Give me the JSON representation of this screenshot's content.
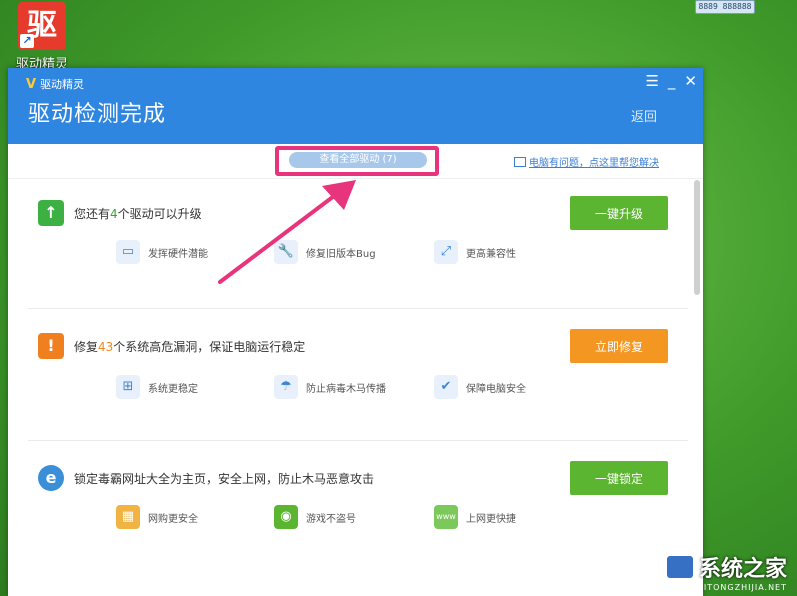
{
  "desktop": {
    "shortcut_label": "驱动精灵",
    "shortcut_logo_char": "驱",
    "tray_text": "8889 888888"
  },
  "window": {
    "app_name": "驱动精灵",
    "title": "驱动检测完成",
    "back_label": "返回",
    "controls": {
      "menu": "☰",
      "minimize": "_",
      "close": "✕"
    },
    "accent": "#2f86e0"
  },
  "toolbar": {
    "view_all_label": "查看全部驱动 (7)",
    "help_link": "电脑有问题，点这里帮您解决"
  },
  "sections": [
    {
      "pre": "您还有",
      "count": "4",
      "post": "个驱动可以升级",
      "button": "一键升级",
      "button_color": "#5cb531",
      "icon_color": "#3cb043",
      "features": [
        {
          "label": "发挥硬件潜能",
          "icon": "monitor-icon"
        },
        {
          "label": "修复旧版本Bug",
          "icon": "wrench-icon"
        },
        {
          "label": "更高兼容性",
          "icon": "expand-icon"
        }
      ]
    },
    {
      "pre": "修复",
      "count": "43",
      "post": "个系统高危漏洞，保证电脑运行稳定",
      "button": "立即修复",
      "button_color": "#f39722",
      "icon_color": "#f07f1f",
      "features": [
        {
          "label": "系统更稳定",
          "icon": "windows-icon"
        },
        {
          "label": "防止病毒木马传播",
          "icon": "umbrella-icon"
        },
        {
          "label": "保障电脑安全",
          "icon": "shield-check-icon"
        }
      ]
    },
    {
      "pre": "",
      "count": "",
      "post": "锁定毒霸网址大全为主页，安全上网，防止木马恶意攻击",
      "button": "一键锁定",
      "button_color": "#5cb531",
      "icon_color": "#3a8fd8",
      "features": [
        {
          "label": "网购更安全",
          "icon": "shop-icon"
        },
        {
          "label": "游戏不盗号",
          "icon": "gamepad-icon"
        },
        {
          "label": "上网更快捷",
          "icon": "www-icon"
        }
      ]
    }
  ],
  "watermark": {
    "title": "系统之家",
    "url": "XITONGZHIJIA.NET"
  }
}
